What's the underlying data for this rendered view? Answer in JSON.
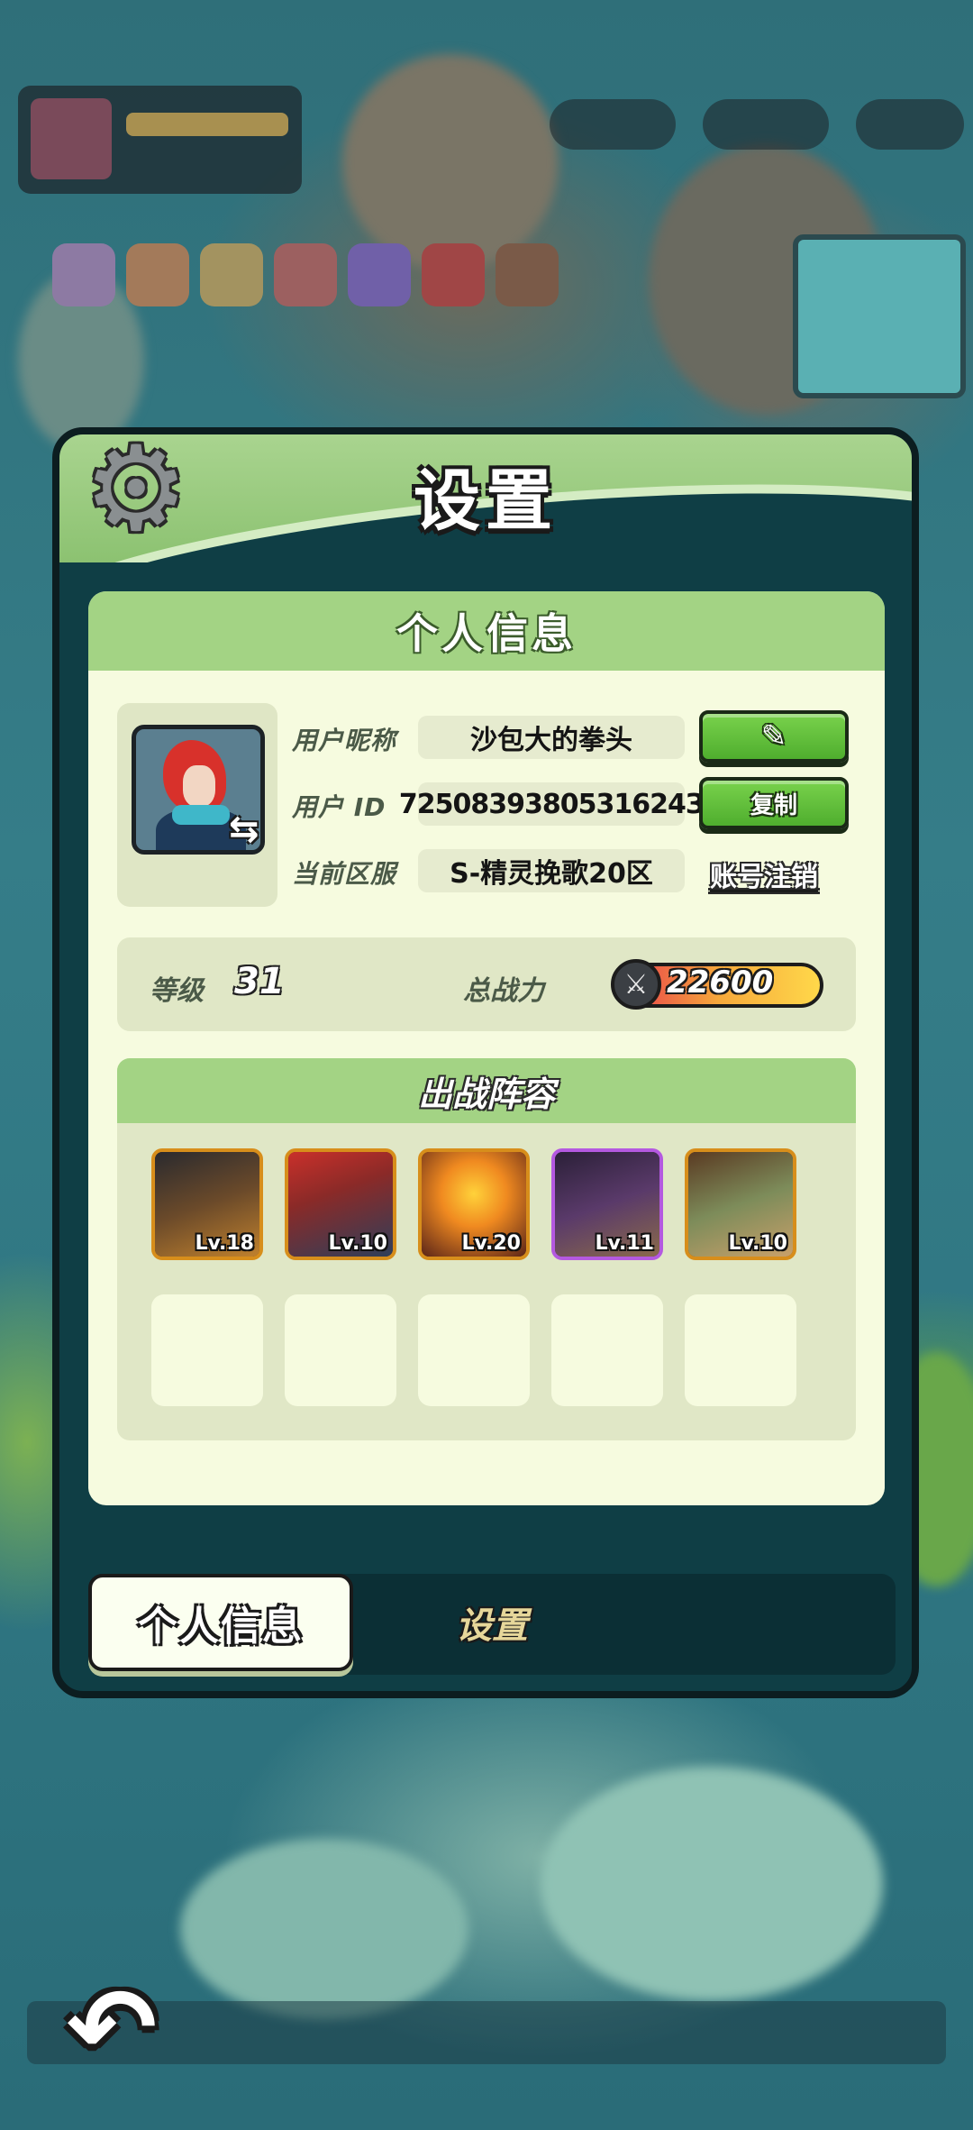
{
  "modal": {
    "title": "设置",
    "card_title": "个人信息"
  },
  "profile": {
    "nickname_label": "用户昵称",
    "nickname": "沙包大的拳头",
    "id_label": "用户 ID",
    "user_id": "7250839380531624З",
    "server_label": "当前区服",
    "server": "S-精灵挽歌20区",
    "copy_button": "复制",
    "deregister_link": "账号注销"
  },
  "stats": {
    "level_label": "等级",
    "level": "31",
    "power_label": "总战力",
    "power": "22600"
  },
  "lineup": {
    "title": "出战阵容",
    "heroes": [
      {
        "level": "Lv.18",
        "rarity_color": "#d78e1b"
      },
      {
        "level": "Lv.10",
        "rarity_color": "#d78e1b"
      },
      {
        "level": "Lv.20",
        "rarity_color": "#d78e1b"
      },
      {
        "level": "Lv.11",
        "rarity_color": "#b459e0"
      },
      {
        "level": "Lv.10",
        "rarity_color": "#d78e1b"
      }
    ],
    "empty_slots": 5
  },
  "tabs": [
    {
      "label": "个人信息",
      "active": true
    },
    {
      "label": "设置",
      "active": false
    }
  ],
  "icons": {
    "settings": "gear-icon",
    "edit": "pencil-icon",
    "swap": "swap-icon",
    "power": "crossed-swords-icon",
    "back": "back-arrow-icon"
  },
  "colors": {
    "header_green": "#a3d384",
    "button_green": "#4fae2e",
    "card_bg": "#f6fbdf",
    "modal_bg": "#0f3e45"
  }
}
